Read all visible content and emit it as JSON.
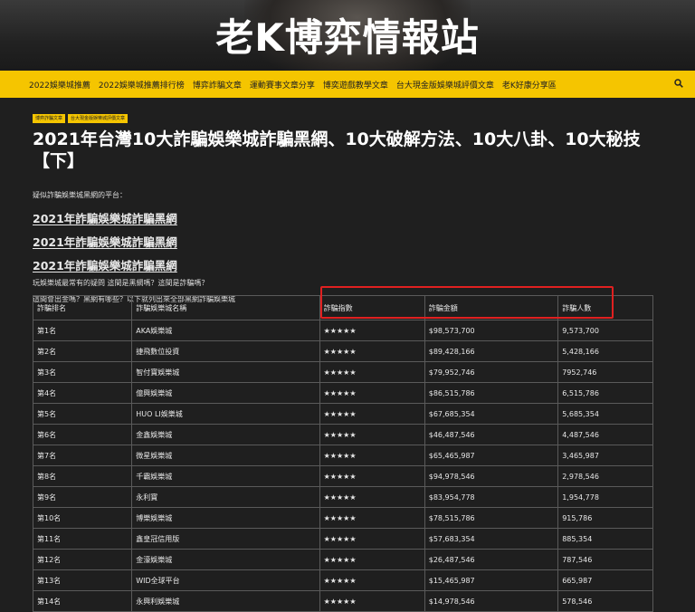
{
  "site": {
    "title": "老K博弈情報站"
  },
  "nav": {
    "items": [
      "2022娛樂城推薦",
      "2022娛樂城推薦排行榜",
      "博弈詐騙文章",
      "運動賽事文章分享",
      "博奕遊戲教學文章",
      "台大現金版娛樂城評價文章",
      "老K好康分享區"
    ]
  },
  "post": {
    "tags": [
      "博弈詐騙文章",
      "台大現金版娛樂城評價文章"
    ],
    "title": "2021年台灣10大詐騙娛樂城詐騙黑網、10大破解方法、10大八卦、10大秘技【下】",
    "intro": "疑似詐騙娛樂城黑網的平台：",
    "links": [
      "2021年詐騙娛樂城詐騙黑網",
      "2021年詐騙娛樂城詐騙黑網",
      "2021年詐騙娛樂城詐騙黑網"
    ],
    "para1": "玩娛樂城最常有的疑問 這間是黑網嗎？這間是詐騙嗎？",
    "para2": "這間會出金嗎？黑網有哪些？以下就列出來全部黑網詐騙娛樂城"
  },
  "table": {
    "headers": [
      "詐騙排名",
      "詐騙娛樂城名稱",
      "詐騙指數",
      "詐騙金額",
      "詐騙人數"
    ],
    "rows": [
      [
        "第1名",
        "AKA娛樂城",
        "★★★★★",
        "$98,573,700",
        "9,573,700"
      ],
      [
        "第2名",
        "捷飛數位投資",
        "★★★★★",
        "$89,428,166",
        "5,428,166"
      ],
      [
        "第3名",
        "智付寶娛樂城",
        "★★★★★",
        "$79,952,746",
        "7952,746"
      ],
      [
        "第4名",
        "億興娛樂城",
        "★★★★★",
        "$86,515,786",
        "6,515,786"
      ],
      [
        "第5名",
        "HUO LI娛樂城",
        "★★★★★",
        "$67,685,354",
        "5,685,354"
      ],
      [
        "第6名",
        "金鑫娛樂城",
        "★★★★★",
        "$46,487,546",
        "4,487,546"
      ],
      [
        "第7名",
        "微星娛樂城",
        "★★★★★",
        "$65,465,987",
        "3,465,987"
      ],
      [
        "第8名",
        "千霸娛樂城",
        "★★★★★",
        "$94,978,546",
        "2,978,546"
      ],
      [
        "第9名",
        "永利寶",
        "★★★★★",
        "$83,954,778",
        "1,954,778"
      ],
      [
        "第10名",
        "博樂娛樂城",
        "★★★★★",
        "$78,515,786",
        "915,786"
      ],
      [
        "第11名",
        "鑫皇冠信用版",
        "★★★★★",
        "$57,683,354",
        "885,354"
      ],
      [
        "第12名",
        "金濠娛樂城",
        "★★★★★",
        "$26,487,546",
        "787,546"
      ],
      [
        "第13名",
        "WID全球平台",
        "★★★★★",
        "$15,465,987",
        "665,987"
      ],
      [
        "第14名",
        "永興利娛樂城",
        "★★★★★",
        "$14,978,546",
        "578,546"
      ]
    ]
  },
  "colors": {
    "accent": "#f5c500",
    "background": "#1f1f1f",
    "highlight": "#e02020"
  }
}
